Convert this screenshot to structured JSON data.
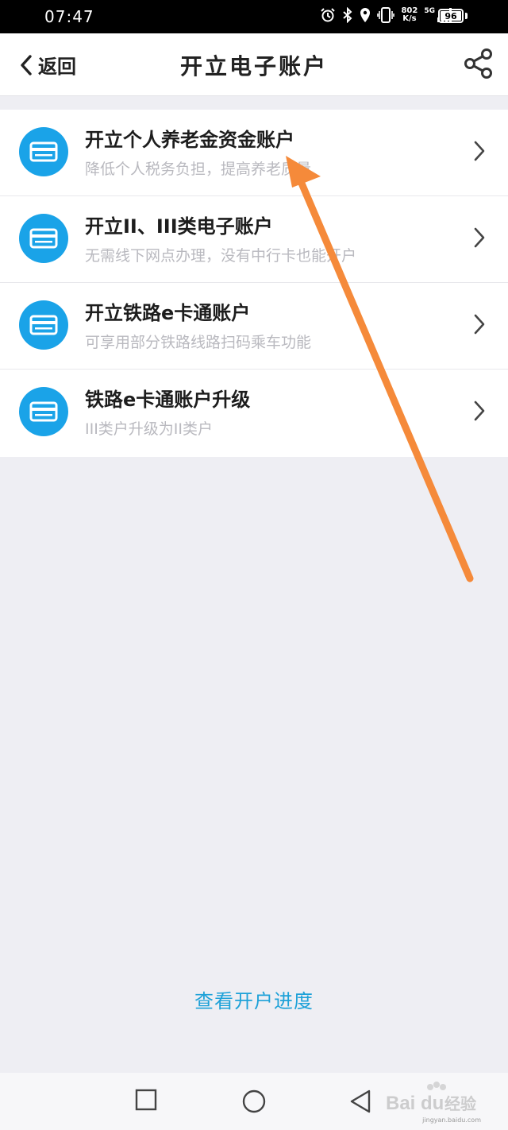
{
  "status_bar": {
    "time": "07:47",
    "net_speed_value": "802",
    "net_speed_unit": "K/s",
    "network_gen": "5G",
    "battery": "96",
    "icons": [
      "alarm-icon",
      "bluetooth-icon",
      "location-icon",
      "vibrate-icon",
      "signal-icon",
      "battery-icon"
    ]
  },
  "nav": {
    "back_label": "返回",
    "title": "开立电子账户"
  },
  "accent_color": "#1da1d8",
  "list": [
    {
      "title": "开立个人养老金资金账户",
      "subtitle": "降低个人税务负担，提高养老质量"
    },
    {
      "title": "开立II、III类电子账户",
      "subtitle": "无需线下网点办理，没有中行卡也能开户"
    },
    {
      "title": "开立铁路e卡通账户",
      "subtitle": "可享用部分铁路线路扫码乘车功能"
    },
    {
      "title": "铁路e卡通账户升级",
      "subtitle": "III类户升级为II类户"
    }
  ],
  "footer": {
    "progress_link": "查看开户进度"
  },
  "watermark": {
    "logo": "Bai 经验",
    "url": "jingyan.baidu.com"
  }
}
